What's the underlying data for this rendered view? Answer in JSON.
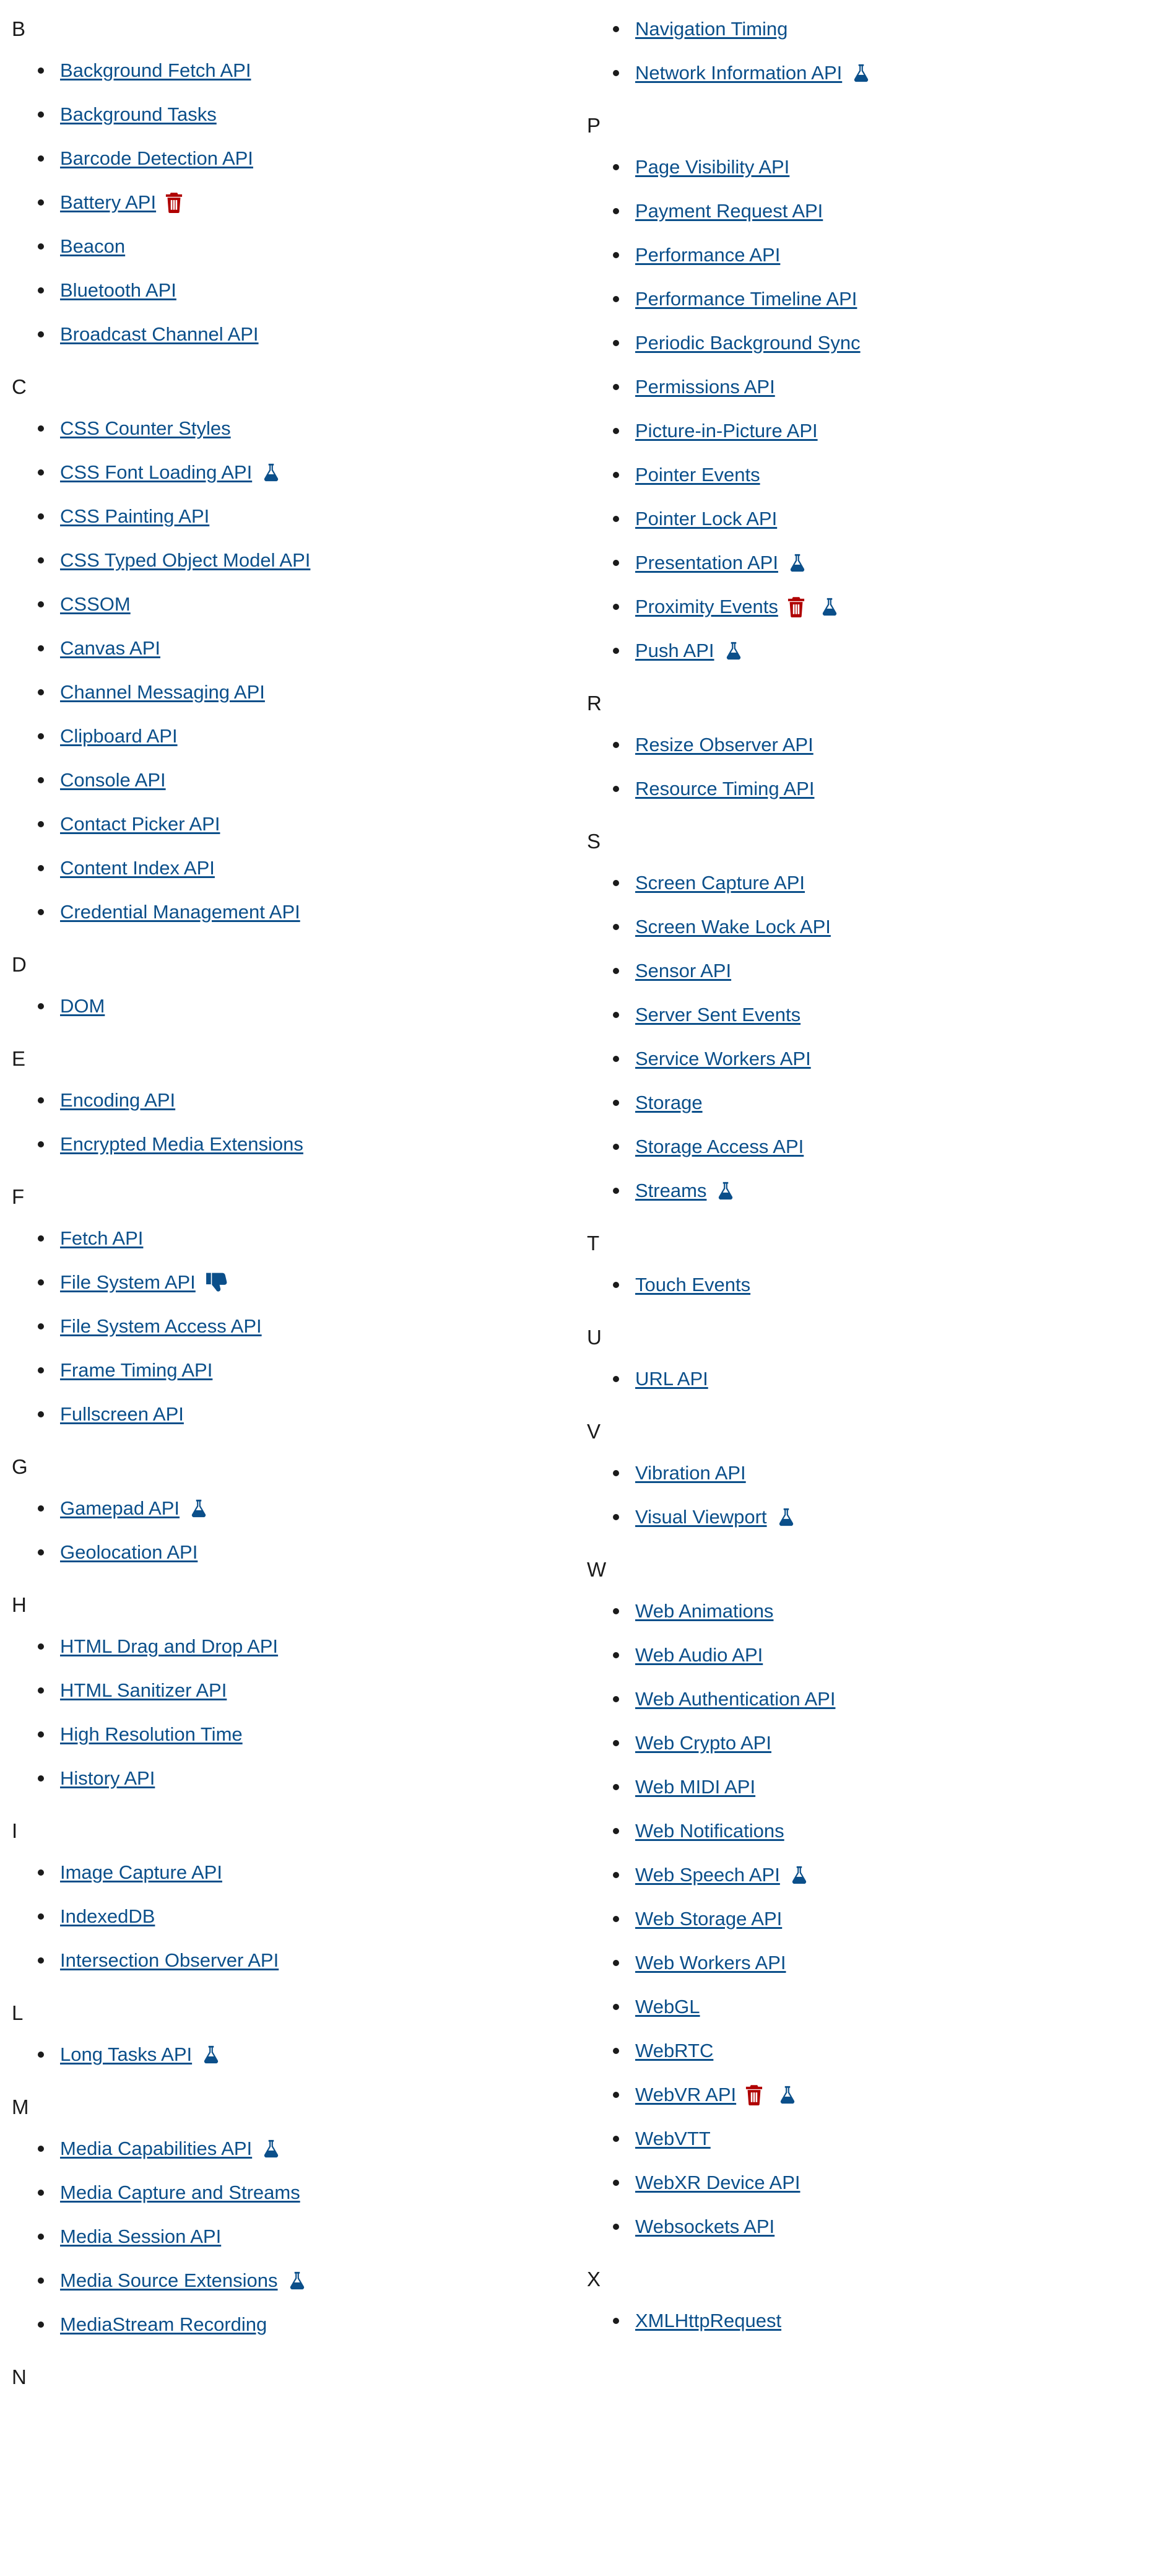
{
  "colors": {
    "link": "#0b4f8a",
    "experimental_icon": "#0b4f8a",
    "deprecated_icon": "#b00000",
    "text": "#1b1b1b"
  },
  "icon_legend": {
    "experimental": "flask-icon",
    "deprecated": "trash-icon",
    "non_standard": "thumbs-down-icon"
  },
  "left_column": [
    {
      "letter": "B",
      "items": [
        {
          "label": "Background Fetch API"
        },
        {
          "label": "Background Tasks"
        },
        {
          "label": "Barcode Detection API"
        },
        {
          "label": "Battery API",
          "icons": [
            "deprecated"
          ]
        },
        {
          "label": "Beacon"
        },
        {
          "label": "Bluetooth API"
        },
        {
          "label": "Broadcast Channel API"
        }
      ]
    },
    {
      "letter": "C",
      "items": [
        {
          "label": "CSS Counter Styles"
        },
        {
          "label": "CSS Font Loading API",
          "icons": [
            "experimental"
          ]
        },
        {
          "label": "CSS Painting API"
        },
        {
          "label": "CSS Typed Object Model API"
        },
        {
          "label": "CSSOM"
        },
        {
          "label": "Canvas API"
        },
        {
          "label": "Channel Messaging API"
        },
        {
          "label": "Clipboard API"
        },
        {
          "label": "Console API"
        },
        {
          "label": "Contact Picker API"
        },
        {
          "label": "Content Index API"
        },
        {
          "label": "Credential Management API"
        }
      ]
    },
    {
      "letter": "D",
      "items": [
        {
          "label": "DOM"
        }
      ]
    },
    {
      "letter": "E",
      "items": [
        {
          "label": "Encoding API"
        },
        {
          "label": "Encrypted Media Extensions"
        }
      ]
    },
    {
      "letter": "F",
      "items": [
        {
          "label": "Fetch API"
        },
        {
          "label": "File System API",
          "icons": [
            "non_standard"
          ]
        },
        {
          "label": "File System Access API"
        },
        {
          "label": "Frame Timing API"
        },
        {
          "label": "Fullscreen API"
        }
      ]
    },
    {
      "letter": "G",
      "items": [
        {
          "label": "Gamepad API",
          "icons": [
            "experimental"
          ]
        },
        {
          "label": "Geolocation API"
        }
      ]
    },
    {
      "letter": "H",
      "items": [
        {
          "label": "HTML Drag and Drop API"
        },
        {
          "label": "HTML Sanitizer API"
        },
        {
          "label": "High Resolution Time"
        },
        {
          "label": "History API"
        }
      ]
    },
    {
      "letter": "I",
      "items": [
        {
          "label": "Image Capture API"
        },
        {
          "label": "IndexedDB"
        },
        {
          "label": "Intersection Observer API"
        }
      ]
    },
    {
      "letter": "L",
      "items": [
        {
          "label": "Long Tasks API",
          "icons": [
            "experimental"
          ]
        }
      ]
    },
    {
      "letter": "M",
      "items": [
        {
          "label": "Media Capabilities API",
          "icons": [
            "experimental"
          ]
        },
        {
          "label": "Media Capture and Streams"
        },
        {
          "label": "Media Session API"
        },
        {
          "label": "Media Source Extensions",
          "icons": [
            "experimental"
          ]
        },
        {
          "label": "MediaStream Recording"
        }
      ]
    },
    {
      "letter": "N",
      "items": []
    }
  ],
  "right_column_continuation": [
    {
      "label": "Navigation Timing"
    },
    {
      "label": "Network Information API",
      "icons": [
        "experimental"
      ]
    }
  ],
  "right_column": [
    {
      "letter": "P",
      "items": [
        {
          "label": "Page Visibility API"
        },
        {
          "label": "Payment Request API"
        },
        {
          "label": "Performance API"
        },
        {
          "label": "Performance Timeline API"
        },
        {
          "label": "Periodic Background Sync"
        },
        {
          "label": "Permissions API"
        },
        {
          "label": "Picture-in-Picture API"
        },
        {
          "label": "Pointer Events"
        },
        {
          "label": "Pointer Lock API"
        },
        {
          "label": "Presentation API",
          "icons": [
            "experimental"
          ]
        },
        {
          "label": "Proximity Events",
          "icons": [
            "deprecated",
            "experimental"
          ]
        },
        {
          "label": "Push API",
          "icons": [
            "experimental"
          ]
        }
      ]
    },
    {
      "letter": "R",
      "items": [
        {
          "label": "Resize Observer API"
        },
        {
          "label": "Resource Timing API"
        }
      ]
    },
    {
      "letter": "S",
      "items": [
        {
          "label": "Screen Capture API"
        },
        {
          "label": "Screen Wake Lock API"
        },
        {
          "label": "Sensor API"
        },
        {
          "label": "Server Sent Events"
        },
        {
          "label": "Service Workers API"
        },
        {
          "label": "Storage"
        },
        {
          "label": "Storage Access API"
        },
        {
          "label": "Streams",
          "icons": [
            "experimental"
          ]
        }
      ]
    },
    {
      "letter": "T",
      "items": [
        {
          "label": "Touch Events"
        }
      ]
    },
    {
      "letter": "U",
      "items": [
        {
          "label": "URL API"
        }
      ]
    },
    {
      "letter": "V",
      "items": [
        {
          "label": "Vibration API"
        },
        {
          "label": "Visual Viewport",
          "icons": [
            "experimental"
          ]
        }
      ]
    },
    {
      "letter": "W",
      "items": [
        {
          "label": "Web Animations"
        },
        {
          "label": "Web Audio API"
        },
        {
          "label": "Web Authentication API"
        },
        {
          "label": "Web Crypto API"
        },
        {
          "label": "Web MIDI API"
        },
        {
          "label": "Web Notifications"
        },
        {
          "label": "Web Speech API",
          "icons": [
            "experimental"
          ]
        },
        {
          "label": "Web Storage API"
        },
        {
          "label": "Web Workers API"
        },
        {
          "label": "WebGL"
        },
        {
          "label": "WebRTC"
        },
        {
          "label": "WebVR API",
          "icons": [
            "deprecated",
            "experimental"
          ]
        },
        {
          "label": "WebVTT"
        },
        {
          "label": "WebXR Device API"
        },
        {
          "label": "Websockets API"
        }
      ]
    },
    {
      "letter": "X",
      "items": [
        {
          "label": "XMLHttpRequest"
        }
      ]
    }
  ]
}
